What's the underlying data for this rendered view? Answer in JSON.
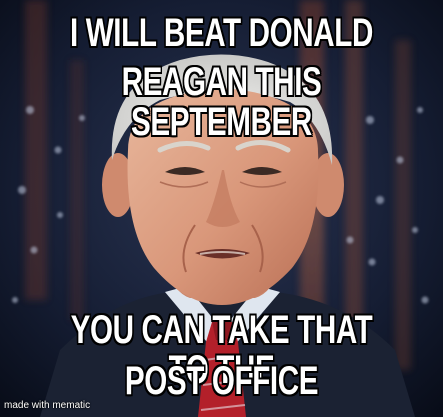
{
  "meme": {
    "top_caption": {
      "line1": "I WILL BEAT DONALD",
      "line2": "REAGAN THIS SEPTEMBER"
    },
    "bottom_caption": {
      "line1": "YOU CAN TAKE THAT TO THE",
      "line2": "POST OFFICE"
    },
    "watermark": "made with mematic"
  },
  "colors": {
    "caption_fill": "#ffffff",
    "caption_outline": "#000000",
    "background_navy": "#15203a",
    "suit": "#1b2233",
    "shirt": "#dfe6ef",
    "tie": "#b3202a"
  }
}
